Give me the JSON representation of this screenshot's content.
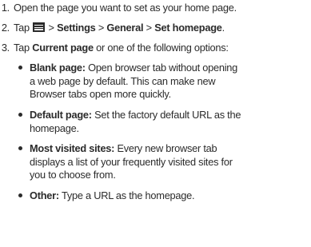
{
  "steps": [
    {
      "number": "1.",
      "text": "Open the page you want to set as your home page."
    },
    {
      "number": "2.",
      "prefix": "Tap",
      "icon": "menu-icon",
      "sep1": ">",
      "settings": "Settings",
      "sep2": ">",
      "general": "General",
      "sep3": ">",
      "set_homepage": "Set homepage",
      "end": "."
    },
    {
      "number": "3.",
      "prefix": "Tap",
      "current_page": "Current page",
      "rest": "or one of the following options:"
    }
  ],
  "options": [
    {
      "title": "Blank page:",
      "lines": [
        "Open browser tab without opening",
        "a web page by default. This can make new",
        "Browser tabs open more quickly."
      ]
    },
    {
      "title": "Default page:",
      "lines": [
        "Set the factory default URL as the",
        "homepage."
      ]
    },
    {
      "title": "Most visited sites:",
      "lines": [
        "Every new browser tab",
        "displays a list of your frequently visited sites for",
        "you to choose from."
      ]
    },
    {
      "title": "Other:",
      "lines": [
        "Type a URL as the homepage."
      ]
    }
  ],
  "colors": {
    "text": "#2b2b2b",
    "background": "#ffffff"
  }
}
